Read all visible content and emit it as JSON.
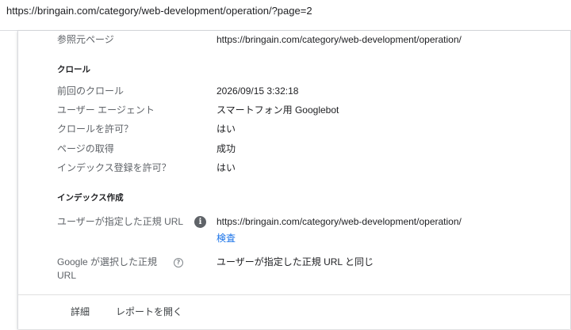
{
  "page_url": "https://bringain.com/category/web-development/operation/?page=2",
  "referring_page": {
    "label": "参照元ページ",
    "value": "https://bringain.com/category/web-development/operation/"
  },
  "crawl": {
    "title": "クロール",
    "rows": [
      {
        "label": "前回のクロール",
        "value": "2026/09/15 3:32:18"
      },
      {
        "label": "ユーザー エージェント",
        "value": "スマートフォン用 Googlebot"
      },
      {
        "label": "クロールを許可？",
        "value": "はい"
      },
      {
        "label": "ページの取得",
        "value": "成功"
      },
      {
        "label": "インデックス登録を許可？",
        "value": "はい"
      }
    ]
  },
  "indexing": {
    "title": "インデックス作成",
    "user_canonical": {
      "label": "ユーザーが指定した正規 URL",
      "value": "https://bringain.com/category/web-development/operation/",
      "inspect_link": "検査",
      "icon": "info-icon"
    },
    "google_canonical": {
      "label_line1": "Google が選択した正規",
      "label_line2": "URL",
      "value": "ユーザーが指定した正規 URL と同じ",
      "icon": "help-icon"
    }
  },
  "footer": {
    "details": "詳細",
    "open_report": "レポートを開く"
  },
  "colors": {
    "link": "#1a73e8",
    "label": "#5f6368",
    "text": "#202124"
  }
}
